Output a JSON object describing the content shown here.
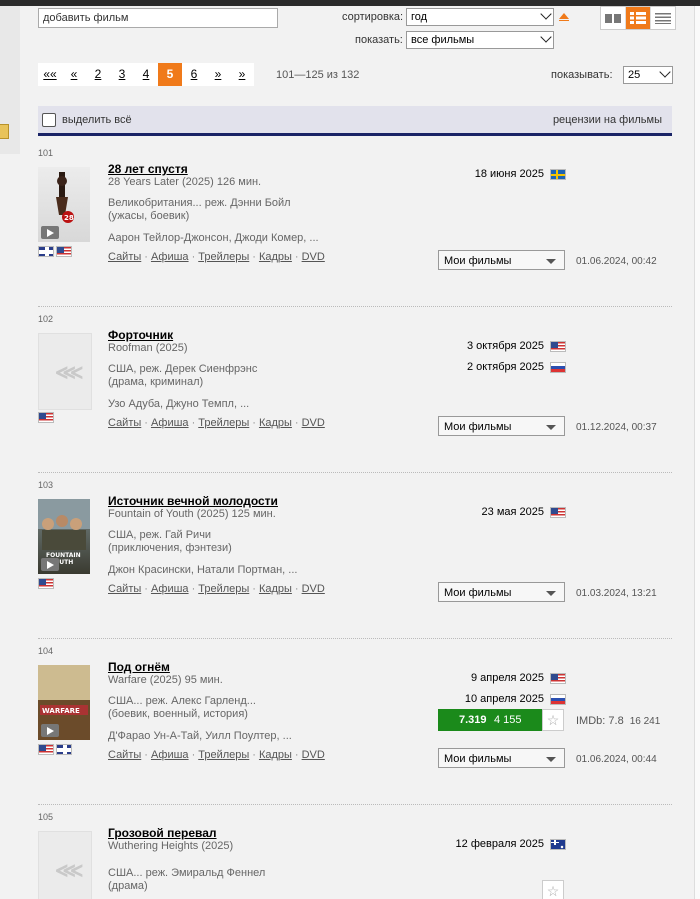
{
  "toolbar": {
    "add_film_value": "добавить фильм",
    "sort_label": "сортировка:",
    "sort_value": "год",
    "show_label": "показать:",
    "show_value": "все фильмы",
    "per_page_label": "показывать:",
    "per_page_value": "25"
  },
  "pager": {
    "pages": [
      "««",
      "«",
      "2",
      "3",
      "4",
      "5",
      "6",
      "»",
      "»"
    ],
    "current": "5",
    "range_text": "101—125 из 132"
  },
  "selbar": {
    "select_all": "выделить всё",
    "reviews": "рецензии на фильмы"
  },
  "films": [
    {
      "num": "101",
      "title": "28 лет спустя",
      "orig": "28 Years Later (2025) 126 мин.",
      "info1": "Великобритания... реж. Дэнни Бойл",
      "info2": "(ужасы, боевик)",
      "cast": "Аарон Тейлор-Джонсон, Джоди Комер, ...",
      "links": [
        "Сайты",
        "Афиша",
        "Трейлеры",
        "Кадры",
        "DVD"
      ],
      "releases": [
        {
          "date": "18 июня 2025",
          "flag": "se"
        }
      ],
      "my_films": "Мои фильмы",
      "added": "01.06.2024, 00:42",
      "flags": [
        "uk",
        "us"
      ]
    },
    {
      "num": "102",
      "title": "Форточник",
      "orig": "Roofman (2025)",
      "info1": "США, реж. Дерек Сиенфрэнс",
      "info2": "(драма, криминал)",
      "cast": "Узо Адуба, Джуно Темпл, ...",
      "links": [
        "Сайты",
        "Афиша",
        "Трейлеры",
        "Кадры",
        "DVD"
      ],
      "releases": [
        {
          "date": "3 октября 2025",
          "flag": "us"
        },
        {
          "date": "2 октября 2025",
          "flag": "ru"
        }
      ],
      "my_films": "Мои фильмы",
      "added": "01.12.2024, 00:37",
      "flags": [
        "us"
      ]
    },
    {
      "num": "103",
      "title": "Источник вечной молодости",
      "orig": "Fountain of Youth (2025) 125 мин.",
      "info1": "США, реж. Гай Ричи",
      "info2": "(приключения, фэнтези)",
      "cast": "Джон Красински, Натали Портман, ...",
      "links": [
        "Сайты",
        "Афиша",
        "Трейлеры",
        "Кадры",
        "DVD"
      ],
      "releases": [
        {
          "date": "23 мая 2025",
          "flag": "us"
        }
      ],
      "my_films": "Мои фильмы",
      "added": "01.03.2024, 13:21",
      "flags": [
        "us"
      ]
    },
    {
      "num": "104",
      "title": "Под огнём",
      "orig": "Warfare (2025) 95 мин.",
      "info1": "США... реж. Алекс Гарленд...",
      "info2": "(боевик, военный, история)",
      "cast": "Д'Фарао Ун-А-Тай, Уилл Поултер, ...",
      "links": [
        "Сайты",
        "Афиша",
        "Трейлеры",
        "Кадры",
        "DVD"
      ],
      "releases": [
        {
          "date": "9 апреля 2025",
          "flag": "us"
        },
        {
          "date": "10 апреля 2025",
          "flag": "ru"
        }
      ],
      "rating": "7.319",
      "votes": "4 155",
      "imdb": "IMDb: 7.8",
      "imdb_votes": "16 241",
      "my_films": "Мои фильмы",
      "added": "01.06.2024, 00:44",
      "flags": [
        "us",
        "uk"
      ]
    },
    {
      "num": "105",
      "title": "Грозовой перевал",
      "orig": "Wuthering Heights (2025)",
      "info1": "США... реж. Эмиральд Феннел",
      "info2": "(драма)",
      "releases": [
        {
          "date": "12 февраля 2025",
          "flag": "au"
        }
      ]
    }
  ],
  "colors": {
    "accent": "#f07a1a",
    "navy": "#1a2466",
    "rating_green": "#1b8a1b"
  }
}
